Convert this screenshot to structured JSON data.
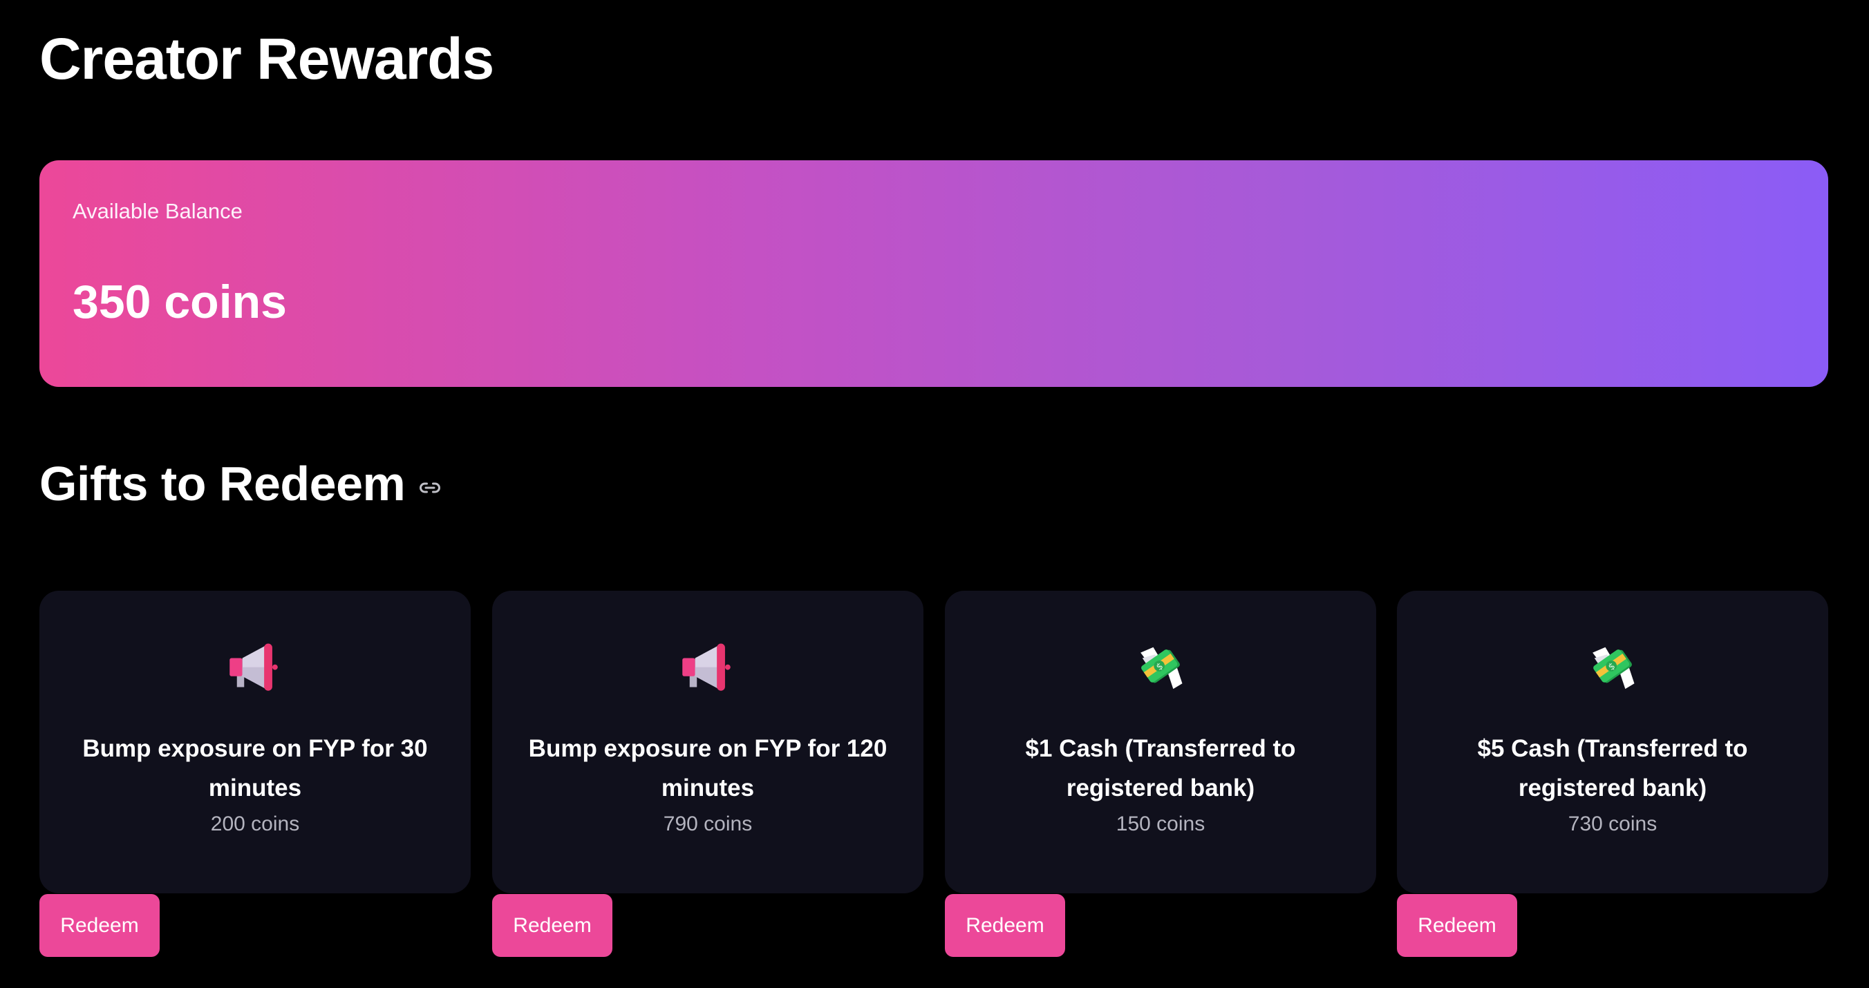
{
  "page": {
    "title": "Creator Rewards"
  },
  "balance": {
    "label": "Available Balance",
    "value": "350 coins"
  },
  "gifts_section": {
    "title": "Gifts to Redeem",
    "link_icon": "link-icon"
  },
  "gifts": [
    {
      "icon": "megaphone-icon",
      "title": "Bump exposure on FYP for 30 minutes",
      "cost": "200 coins",
      "button_label": "Redeem"
    },
    {
      "icon": "megaphone-icon",
      "title": "Bump exposure on FYP for 120 minutes",
      "cost": "790 coins",
      "button_label": "Redeem"
    },
    {
      "icon": "money-with-wings-icon",
      "title": "$1 Cash (Transferred to registered bank)",
      "cost": "150 coins",
      "button_label": "Redeem"
    },
    {
      "icon": "money-with-wings-icon",
      "title": "$5 Cash (Transferred to registered bank)",
      "cost": "730 coins",
      "button_label": "Redeem"
    }
  ],
  "colors": {
    "background": "#000000",
    "gradient_start": "#ec4899",
    "gradient_end": "#8b5cf6",
    "card_background": "#10101c",
    "button": "#ec4899",
    "muted_text": "#b4b4bf"
  }
}
